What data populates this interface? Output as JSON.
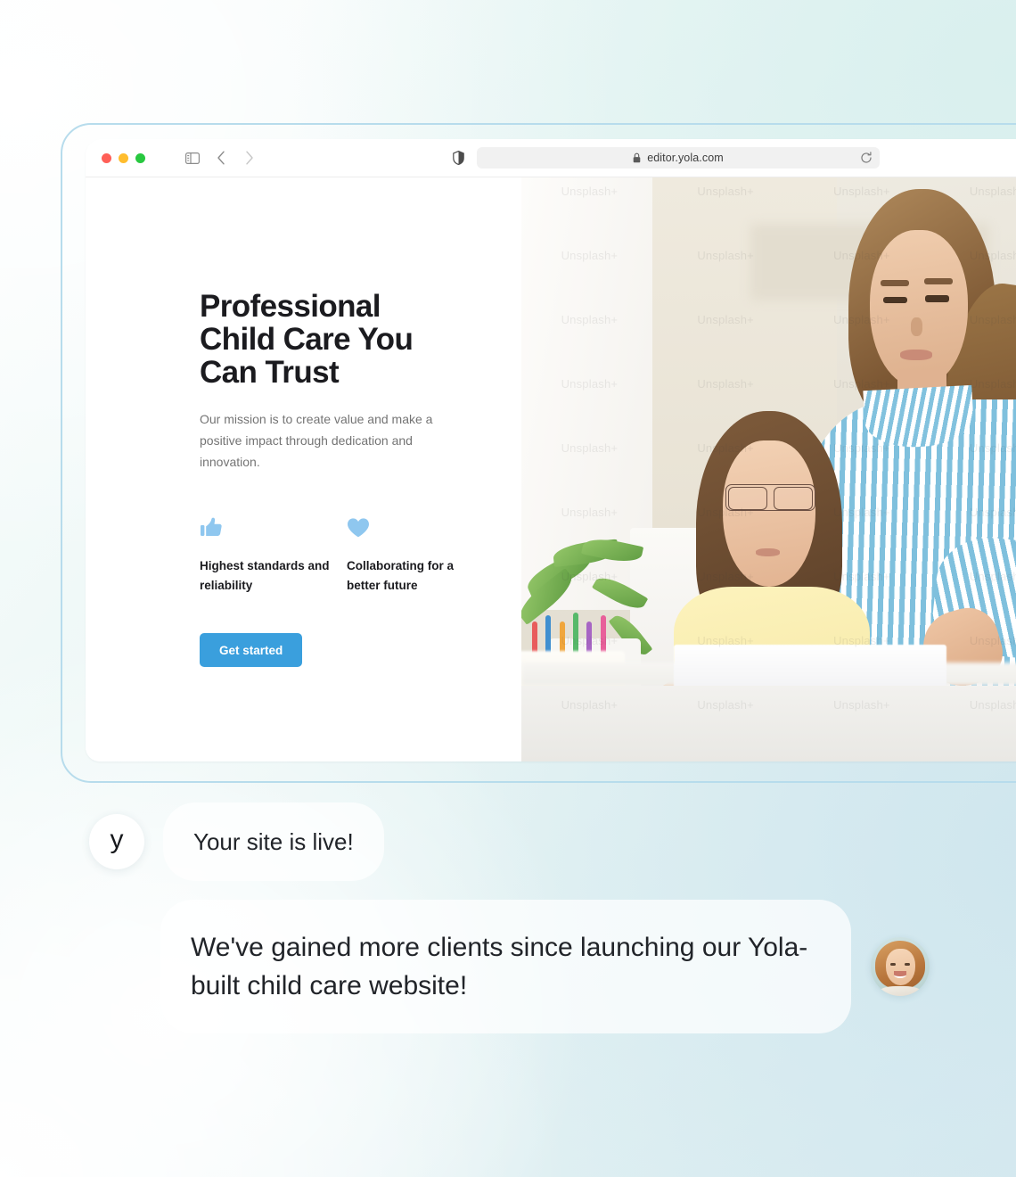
{
  "browser": {
    "window_controls": [
      "close",
      "minimize",
      "zoom"
    ],
    "sidebar_icon": "sidebar-icon",
    "back_label": "‹",
    "forward_label": "›",
    "shield_icon": "shield-icon",
    "lock_icon": "lock-icon",
    "url": "editor.yola.com",
    "reload_icon": "reload-icon"
  },
  "hero": {
    "title": "Professional Child Care You Can Trust",
    "subtitle": "Our mission is to create value and make a positive impact through dedication and innovation.",
    "features": [
      {
        "icon": "thumbs-up-icon",
        "label": "Highest standards and reliability"
      },
      {
        "icon": "heart-icon",
        "label": "Collaborating for a better future"
      }
    ],
    "cta_label": "Get started",
    "photo_alt": "Woman helping a girl with homework at a desk",
    "watermark": "Unsplash+"
  },
  "chat": {
    "brand_initial": "y",
    "messages": [
      {
        "from": "yola",
        "text": "Your site is live!"
      },
      {
        "from": "customer",
        "text": "We've gained more clients since launching our Yola-built child care website!"
      }
    ]
  },
  "colors": {
    "accent_blue": "#3a9fdd",
    "icon_blue": "#8fc7ef",
    "frame_outline": "#b7dcec",
    "bg_mint": "#e3f2f3",
    "bg_blue": "#d7eaf0",
    "text_dark": "#1b1b1f",
    "text_muted": "#747474"
  }
}
